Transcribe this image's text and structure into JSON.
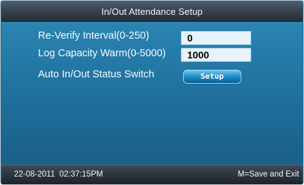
{
  "header": {
    "title": "In/Out Attendance Setup"
  },
  "settings": [
    {
      "label": "Re-Verify Interval(0-250)",
      "value": "0"
    },
    {
      "label": "Log Capacity Warm(0-5000)",
      "value": "1000"
    },
    {
      "label": "Auto In/Out Status Switch",
      "button_label": "Setup"
    }
  ],
  "status_bar": {
    "datetime": "22-08-2011  02:37:15PM",
    "hint": "M=Save and Exit"
  },
  "colors": {
    "background": "#1f6b93",
    "title_bar": "#39434f",
    "input_fill": "#e6f3fb",
    "button_accent": "#1d8bc5"
  }
}
